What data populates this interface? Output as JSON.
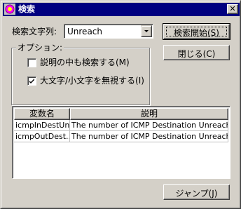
{
  "window": {
    "title": "検索",
    "close_glyph": "✕"
  },
  "search": {
    "label": "検索文字列:",
    "value": "Unreach"
  },
  "options": {
    "group_label": "オプション:",
    "search_description_label": "説明の中も検索する(M)",
    "search_description_checked": false,
    "ignore_case_label": "大文字/小文字を無視する(I)",
    "ignore_case_checked": true
  },
  "buttons": {
    "start_search": "検索開始(S)",
    "close": "閉じる(C)",
    "jump": "ジャンプ(J)"
  },
  "table": {
    "columns": [
      "変数名",
      "説明"
    ],
    "rows": [
      [
        "icmpInDestUn...",
        "The number of ICMP Destination Unreach..."
      ],
      [
        "icmpOutDest...",
        "The number of ICMP Destination Unreach..."
      ]
    ]
  },
  "icons": {
    "app_icon": "app-icon",
    "close_icon": "close-icon",
    "check_icon": "check-icon",
    "dropdown_icon": "chevron-down-icon"
  }
}
